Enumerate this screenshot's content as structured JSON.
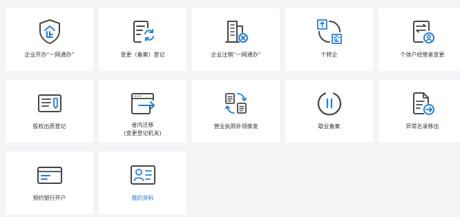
{
  "services": [
    {
      "label": "企业开办“一网通办”",
      "icon": "shield-enterprise-icon"
    },
    {
      "label": "变更（备案）登记",
      "icon": "document-refresh-icon"
    },
    {
      "label": "企业注销“一网通办”",
      "icon": "building-cancel-icon"
    },
    {
      "label": "个转企",
      "icon": "person-to-enterprise-icon"
    },
    {
      "label": "个体户经营者变更",
      "icon": "document-user-icon"
    },
    {
      "label": "股权出质登记",
      "icon": "pledge-document-icon"
    },
    {
      "label": "省内迁移\n(变更登记机关)",
      "icon": "window-migrate-icon"
    },
    {
      "label": "营业执照补领换发",
      "icon": "license-exchange-icon"
    },
    {
      "label": "歇业备案",
      "icon": "pause-icon"
    },
    {
      "label": "异常名录移出",
      "icon": "document-arrow-out-icon"
    },
    {
      "label": "预约银行开户",
      "icon": "bank-card-icon"
    },
    {
      "label": "我的资料",
      "icon": "id-card-icon"
    }
  ],
  "colors": {
    "accent": "#1677d6",
    "icon_stroke": "#444444",
    "icon_accent": "#1a7fe0",
    "tile_bg": "#ffffff",
    "page_bg": "#f3f4f6"
  }
}
